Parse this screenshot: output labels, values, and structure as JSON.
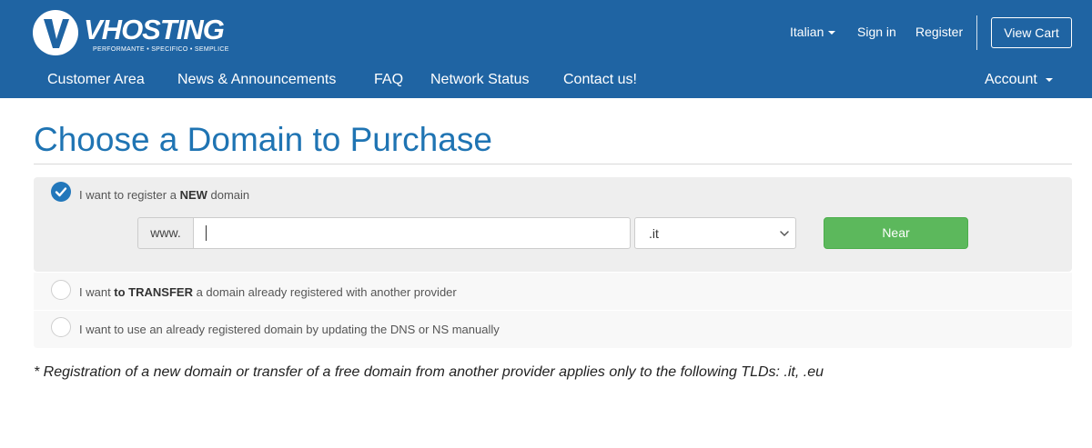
{
  "brand": {
    "name": "VHOSTING",
    "tagline": "PERFORMANTE • SPECIFICO • SEMPLICE"
  },
  "top_links": {
    "language": "Italian",
    "sign_in": "Sign in",
    "register": "Register",
    "view_cart": "View Cart"
  },
  "nav": {
    "items": [
      "Customer Area",
      "News & Announcements",
      "FAQ",
      "Network Status",
      "Contact us!"
    ],
    "account": "Account"
  },
  "page": {
    "title": "Choose a Domain to Purchase"
  },
  "options": {
    "new_domain": {
      "prefix": "I want to register a ",
      "bold": "NEW",
      "suffix": " domain",
      "checked": true
    },
    "transfer": {
      "prefix": "I want ",
      "bold": "to TRANSFER",
      "suffix": " a domain already registered with another provider",
      "checked": false
    },
    "existing": {
      "text": "I want to use an already registered domain by updating the DNS or NS manually",
      "checked": false
    }
  },
  "domain_form": {
    "www_label": "www.",
    "domain_value": "",
    "tld_selected": ".it",
    "submit_label": "Near"
  },
  "footnote": "* Registration of a new domain or transfer of a free domain from another provider applies only to the following TLDs: .it, .eu",
  "colors": {
    "header_bg": "#1f64a3",
    "title": "#1f74b3",
    "radio_checked": "#2277bb",
    "button_green": "#5cb85c"
  }
}
